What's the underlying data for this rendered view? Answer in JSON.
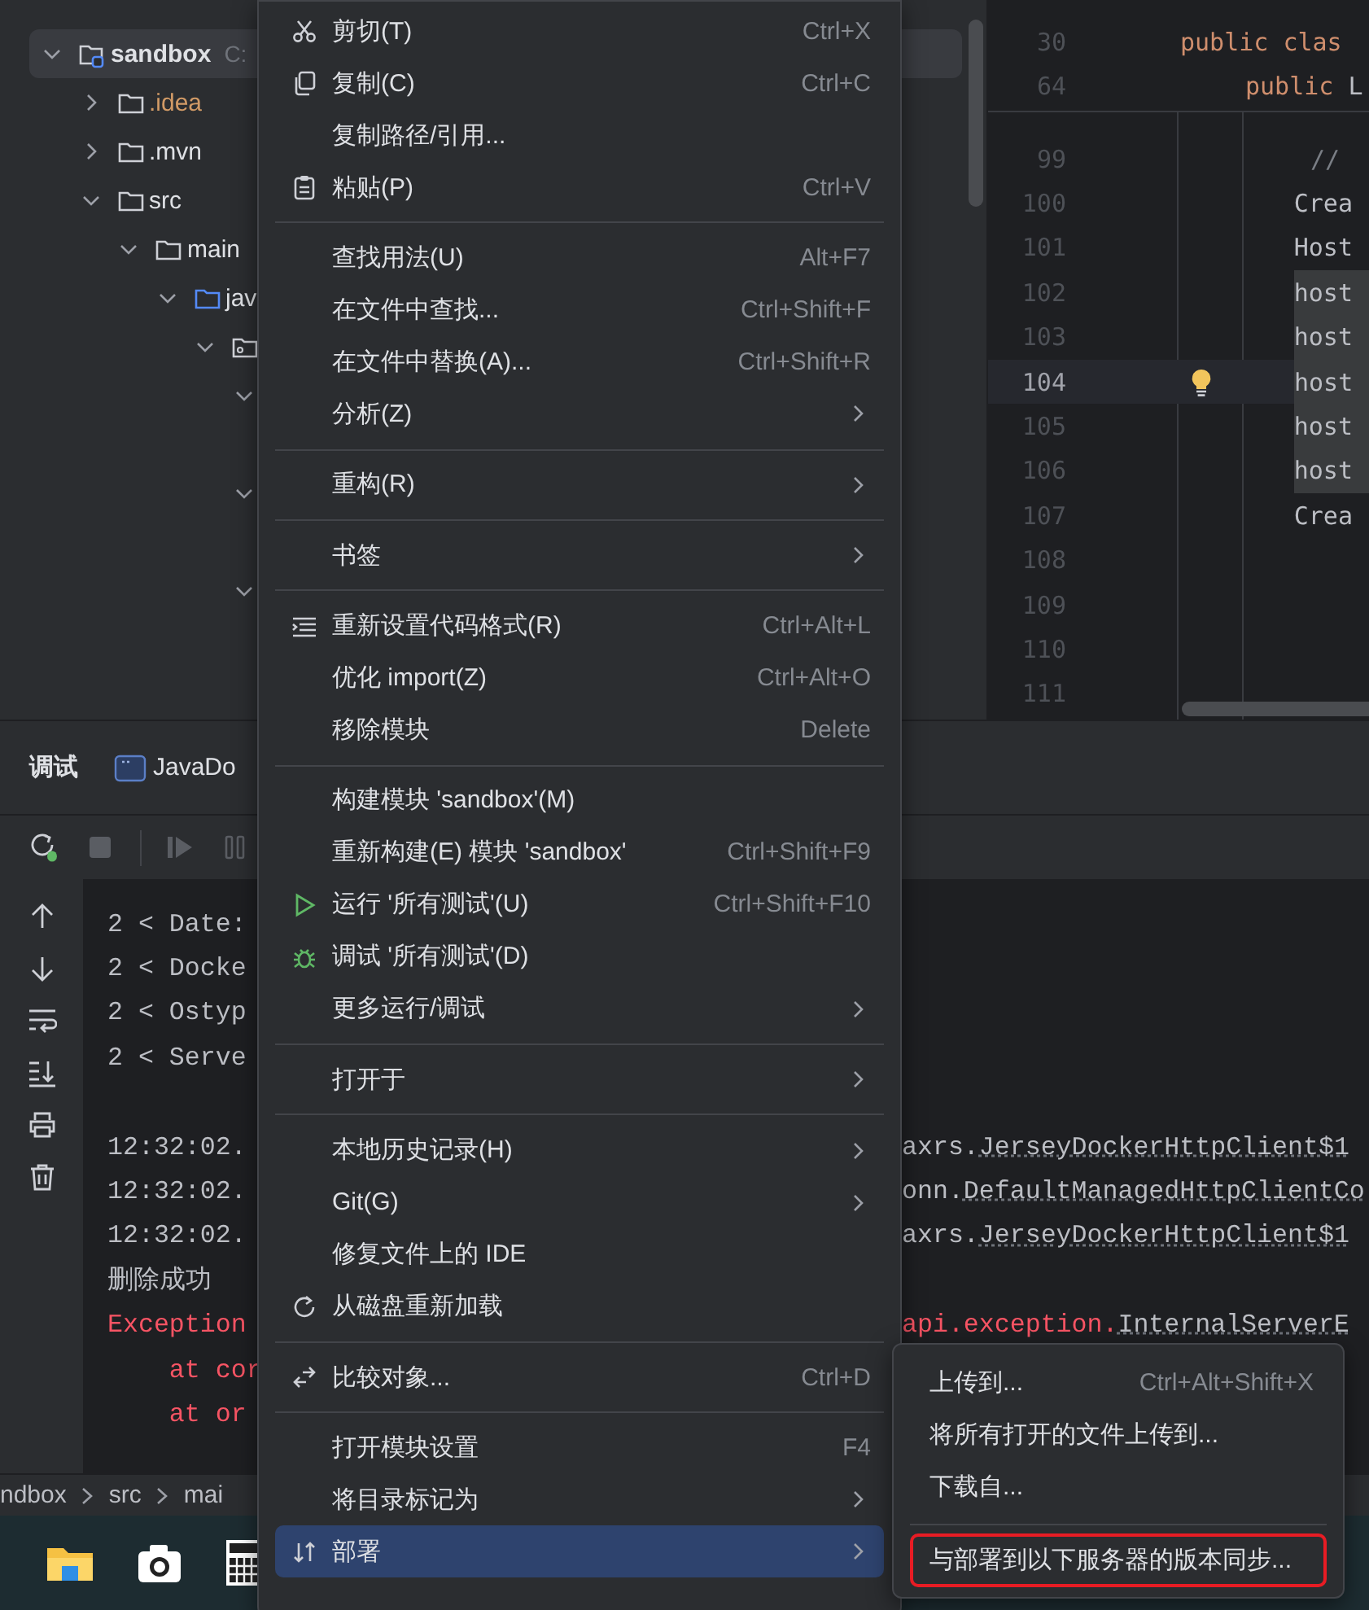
{
  "project_tree": [
    {
      "name": "sandbox",
      "path": "C:",
      "kind": "module",
      "color": "#dfe1e5",
      "expanded": true,
      "selected": true,
      "children": [
        {
          "name": ".idea",
          "kind": "folder",
          "color": "#d19a66",
          "expanded": false,
          "selected": false
        },
        {
          "name": ".mvn",
          "kind": "folder",
          "color": "#dfe1e5",
          "expanded": false,
          "selected": false
        },
        {
          "name": "src",
          "kind": "folder",
          "color": "#dfe1e5",
          "expanded": true,
          "selected": false,
          "children": [
            {
              "name": "main",
              "kind": "folder",
              "color": "#dfe1e5",
              "expanded": true,
              "selected": false,
              "children": [
                {
                  "name": "jav",
                  "kind": "source",
                  "color": "#dfe1e5",
                  "expanded": true,
                  "selected": false,
                  "children": [
                    {
                      "kind": "package",
                      "expanded": true,
                      "selected": false,
                      "children": [
                        {
                          "kind": "covered",
                          "expanded": true,
                          "selected": false
                        },
                        {
                          "kind": "spacer"
                        },
                        {
                          "kind": "covered",
                          "expanded": true,
                          "selected": false
                        },
                        {
                          "kind": "spacer"
                        },
                        {
                          "kind": "covered",
                          "expanded": true,
                          "selected": false
                        }
                      ]
                    }
                  ]
                }
              ]
            }
          ]
        }
      ]
    }
  ],
  "editor": {
    "sticky_lines": [
      {
        "number": "30",
        "tokens": [
          {
            "text": "public clas",
            "kind": "keyword"
          }
        ],
        "children": [
          {
            "number": "64",
            "tokens": [
              {
                "text": "public",
                "kind": "keyword"
              },
              {
                "text": " L",
                "kind": "plain"
              }
            ]
          }
        ]
      }
    ],
    "lines": [
      {
        "number": "99",
        "current": false,
        "highlighted": false,
        "bulb": false,
        "tokens": [
          {
            "text": "//",
            "kind": "comment"
          }
        ]
      },
      {
        "number": "100",
        "current": false,
        "highlighted": false,
        "bulb": false,
        "tokens": [
          {
            "text": "Crea",
            "kind": "plain"
          }
        ]
      },
      {
        "number": "101",
        "current": false,
        "highlighted": false,
        "bulb": false,
        "tokens": [
          {
            "text": "Host",
            "kind": "plain"
          }
        ]
      },
      {
        "number": "102",
        "current": false,
        "highlighted": true,
        "bulb": false,
        "tokens": [
          {
            "text": "host",
            "kind": "plain"
          }
        ]
      },
      {
        "number": "103",
        "current": false,
        "highlighted": true,
        "bulb": false,
        "tokens": [
          {
            "text": "host",
            "kind": "plain"
          }
        ]
      },
      {
        "number": "104",
        "current": true,
        "highlighted": true,
        "bulb": true,
        "tokens": [
          {
            "text": "host",
            "kind": "plain"
          }
        ]
      },
      {
        "number": "105",
        "current": false,
        "highlighted": true,
        "bulb": false,
        "tokens": [
          {
            "text": "host",
            "kind": "plain"
          }
        ]
      },
      {
        "number": "106",
        "current": false,
        "highlighted": true,
        "bulb": false,
        "tokens": [
          {
            "text": "host",
            "kind": "plain"
          }
        ]
      },
      {
        "number": "107",
        "current": false,
        "highlighted": false,
        "bulb": false,
        "tokens": [
          {
            "text": "Crea",
            "kind": "plain"
          }
        ]
      },
      {
        "number": "108",
        "current": false,
        "bulb": false
      },
      {
        "number": "109",
        "current": false,
        "bulb": false
      },
      {
        "number": "110",
        "current": false,
        "bulb": false
      },
      {
        "number": "111",
        "current": false,
        "bulb": false
      }
    ]
  },
  "tool_window": {
    "tabs": [
      {
        "label": "调试",
        "selected": true,
        "icon": false
      },
      {
        "label": "JavaDo",
        "selected": false,
        "icon": true
      }
    ],
    "console": [
      {
        "kind": "normal",
        "left": "2 < Date:"
      },
      {
        "kind": "normal",
        "left": "2 < Docke"
      },
      {
        "kind": "normal",
        "left": "2 < Ostyp"
      },
      {
        "kind": "normal",
        "left": "2 < Serve"
      },
      {
        "kind": "blank"
      },
      {
        "kind": "normal",
        "left": "12:32:02.",
        "right": "axrs.",
        "link": "JerseyDockerHttpClient$1"
      },
      {
        "kind": "normal",
        "left": "12:32:02.",
        "right": "onn.",
        "link": "DefaultManagedHttpClientCo"
      },
      {
        "kind": "normal",
        "left": "12:32:02.",
        "right": "axrs.",
        "link": "JerseyDockerHttpClient$1"
      },
      {
        "kind": "normal",
        "left": "删除成功"
      },
      {
        "kind": "error",
        "left": "Exception",
        "right": "api.exception.",
        "link": "InternalServerE"
      },
      {
        "kind": "error",
        "left": "    at cor"
      },
      {
        "kind": "error",
        "left": "    at or"
      }
    ]
  },
  "breadcrumb": [
    "ndbox",
    "src",
    "mai"
  ],
  "context_menu": [
    {
      "kind": "cut",
      "label": "剪切(T)",
      "shortcut": "Ctrl+X",
      "submenu": false,
      "selected": false
    },
    {
      "kind": "copy",
      "label": "复制(C)",
      "shortcut": "Ctrl+C",
      "submenu": false,
      "selected": false
    },
    {
      "kind": "plain",
      "label": "复制路径/引用...",
      "submenu": false,
      "selected": false
    },
    {
      "kind": "paste",
      "label": "粘贴(P)",
      "shortcut": "Ctrl+V",
      "submenu": false,
      "selected": false
    },
    {
      "kind": "separator"
    },
    {
      "kind": "plain",
      "label": "查找用法(U)",
      "shortcut": "Alt+F7",
      "submenu": false,
      "selected": false
    },
    {
      "kind": "plain",
      "label": "在文件中查找...",
      "shortcut": "Ctrl+Shift+F",
      "submenu": false,
      "selected": false
    },
    {
      "kind": "plain",
      "label": "在文件中替换(A)...",
      "shortcut": "Ctrl+Shift+R",
      "submenu": false,
      "selected": false
    },
    {
      "kind": "plain",
      "label": "分析(Z)",
      "submenu": true,
      "selected": false
    },
    {
      "kind": "separator"
    },
    {
      "kind": "plain",
      "label": "重构(R)",
      "submenu": true,
      "selected": false
    },
    {
      "kind": "separator"
    },
    {
      "kind": "plain",
      "label": "书签",
      "submenu": true,
      "selected": false
    },
    {
      "kind": "separator"
    },
    {
      "kind": "format",
      "label": "重新设置代码格式(R)",
      "shortcut": "Ctrl+Alt+L",
      "submenu": false,
      "selected": false
    },
    {
      "kind": "plain",
      "label": "优化 import(Z)",
      "shortcut": "Ctrl+Alt+O",
      "submenu": false,
      "selected": false
    },
    {
      "kind": "plain",
      "label": "移除模块",
      "shortcut": "Delete",
      "submenu": false,
      "selected": false
    },
    {
      "kind": "separator"
    },
    {
      "kind": "plain",
      "label": "构建模块 'sandbox'(M)",
      "submenu": false,
      "selected": false
    },
    {
      "kind": "plain",
      "label": "重新构建(E) 模块 'sandbox'",
      "shortcut": "Ctrl+Shift+F9",
      "submenu": false,
      "selected": false
    },
    {
      "kind": "run",
      "label": "运行 '所有测试'(U)",
      "shortcut": "Ctrl+Shift+F10",
      "submenu": false,
      "selected": false
    },
    {
      "kind": "debug",
      "label": "调试 '所有测试'(D)",
      "submenu": false,
      "selected": false
    },
    {
      "kind": "plain",
      "label": "更多运行/调试",
      "submenu": true,
      "selected": false
    },
    {
      "kind": "separator"
    },
    {
      "kind": "plain",
      "label": "打开于",
      "submenu": true,
      "selected": false
    },
    {
      "kind": "separator"
    },
    {
      "kind": "plain",
      "label": "本地历史记录(H)",
      "submenu": true,
      "selected": false
    },
    {
      "kind": "plain",
      "label": "Git(G)",
      "submenu": true,
      "selected": false
    },
    {
      "kind": "plain",
      "label": "修复文件上的 IDE",
      "submenu": false,
      "selected": false
    },
    {
      "kind": "reload",
      "label": "从磁盘重新加载",
      "submenu": false,
      "selected": false
    },
    {
      "kind": "separator"
    },
    {
      "kind": "compare",
      "label": "比较对象...",
      "shortcut": "Ctrl+D",
      "submenu": false,
      "selected": false
    },
    {
      "kind": "separator"
    },
    {
      "kind": "plain",
      "label": "打开模块设置",
      "shortcut": "F4",
      "submenu": false,
      "selected": false
    },
    {
      "kind": "plain",
      "label": "将目录标记为",
      "submenu": true,
      "selected": false
    },
    {
      "kind": "deploy",
      "label": "部署",
      "submenu": true,
      "selected": true
    }
  ],
  "submenu": [
    {
      "kind": "plain",
      "label": "上传到...",
      "shortcut": "Ctrl+Alt+Shift+X",
      "marked": false
    },
    {
      "kind": "plain",
      "label": "将所有打开的文件上传到...",
      "marked": false
    },
    {
      "kind": "plain",
      "label": "下载自...",
      "marked": false
    },
    {
      "kind": "separator"
    },
    {
      "kind": "plain",
      "label": "与部署到以下服务器的版本同步...",
      "marked": true
    }
  ]
}
